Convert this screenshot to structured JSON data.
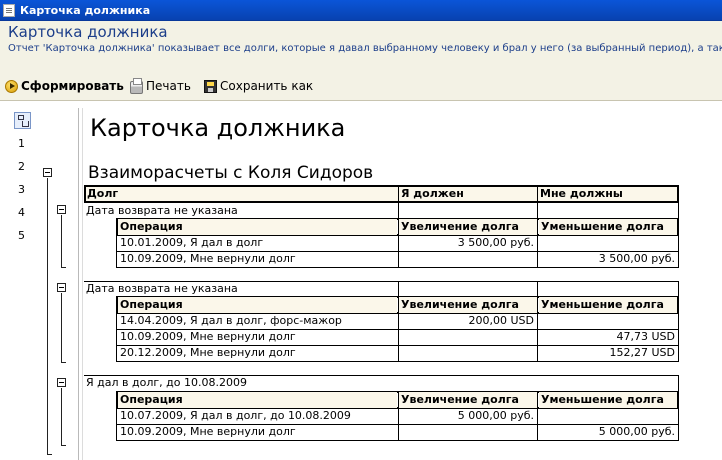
{
  "window": {
    "title": "Карточка должника"
  },
  "header": {
    "title": "Карточка должника",
    "description": "Отчет 'Карточка должника' показывает все долги, которые я давал выбранному человеку и брал у него (за выбранный период), а также м"
  },
  "toolbar": {
    "generate": "Сформировать",
    "print": "Печать",
    "save_as": "Сохранить как"
  },
  "levels": [
    "1",
    "2",
    "3",
    "4",
    "5"
  ],
  "report": {
    "title": "Карточка должника",
    "subtitle": "Взаиморасчеты с Коля Сидоров",
    "columns": [
      "Долг",
      "Я должен",
      "Мне должны"
    ],
    "sub_columns": [
      "Операция",
      "Увеличение долга",
      "Уменьшение долга"
    ],
    "groups": [
      {
        "label": "Дата возврата не указана",
        "rows": [
          [
            "10.01.2009, Я дал в долг",
            "3 500,00 руб.",
            ""
          ],
          [
            "10.09.2009, Мне вернули долг",
            "",
            "3 500,00 руб."
          ]
        ]
      },
      {
        "label": "Дата возврата не указана",
        "rows": [
          [
            "14.04.2009, Я дал в долг, форс-мажор",
            "200,00 USD",
            ""
          ],
          [
            "10.09.2009, Мне вернули долг",
            "",
            "47,73 USD"
          ],
          [
            "20.12.2009, Мне вернули долг",
            "",
            "152,27 USD"
          ]
        ]
      },
      {
        "label": "Я дал в долг, до 10.08.2009",
        "rows": [
          [
            "10.07.2009, Я дал в долг, до 10.08.2009",
            "5 000,00 руб.",
            ""
          ],
          [
            "10.09.2009, Мне вернули долг",
            "",
            "5 000,00 руб."
          ]
        ]
      }
    ]
  }
}
